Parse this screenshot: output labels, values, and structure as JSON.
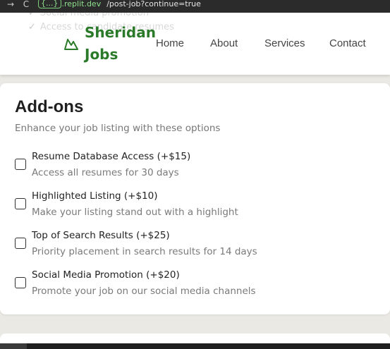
{
  "browser": {
    "back_icon": "→",
    "reload_icon": "C",
    "url_badge": "{...}",
    "url_domain": ".replit.dev",
    "url_path": "/post-job?continue=true"
  },
  "header": {
    "behind_items": [
      "Social media promotion",
      "Access to candidate resumes"
    ],
    "logo_icon": "mountain-icon",
    "logo_line1": "Sheridan",
    "logo_line2": "Jobs",
    "nav": [
      "Home",
      "About",
      "Services",
      "Contact"
    ],
    "brand_color": "#2a7a2a"
  },
  "addons": {
    "title": "Add-ons",
    "subtitle": "Enhance your job listing with these options",
    "items": [
      {
        "name": "Resume Database Access (+$15)",
        "description": "Access all resumes for 30 days",
        "checked": false
      },
      {
        "name": "Highlighted Listing (+$10)",
        "description": "Make your listing stand out with a highlight",
        "checked": false
      },
      {
        "name": "Top of Search Results (+$25)",
        "description": "Priority placement in search results for 14 days",
        "checked": false
      },
      {
        "name": "Social Media Promotion (+$20)",
        "description": "Promote your job on our social media channels",
        "checked": false
      }
    ]
  }
}
